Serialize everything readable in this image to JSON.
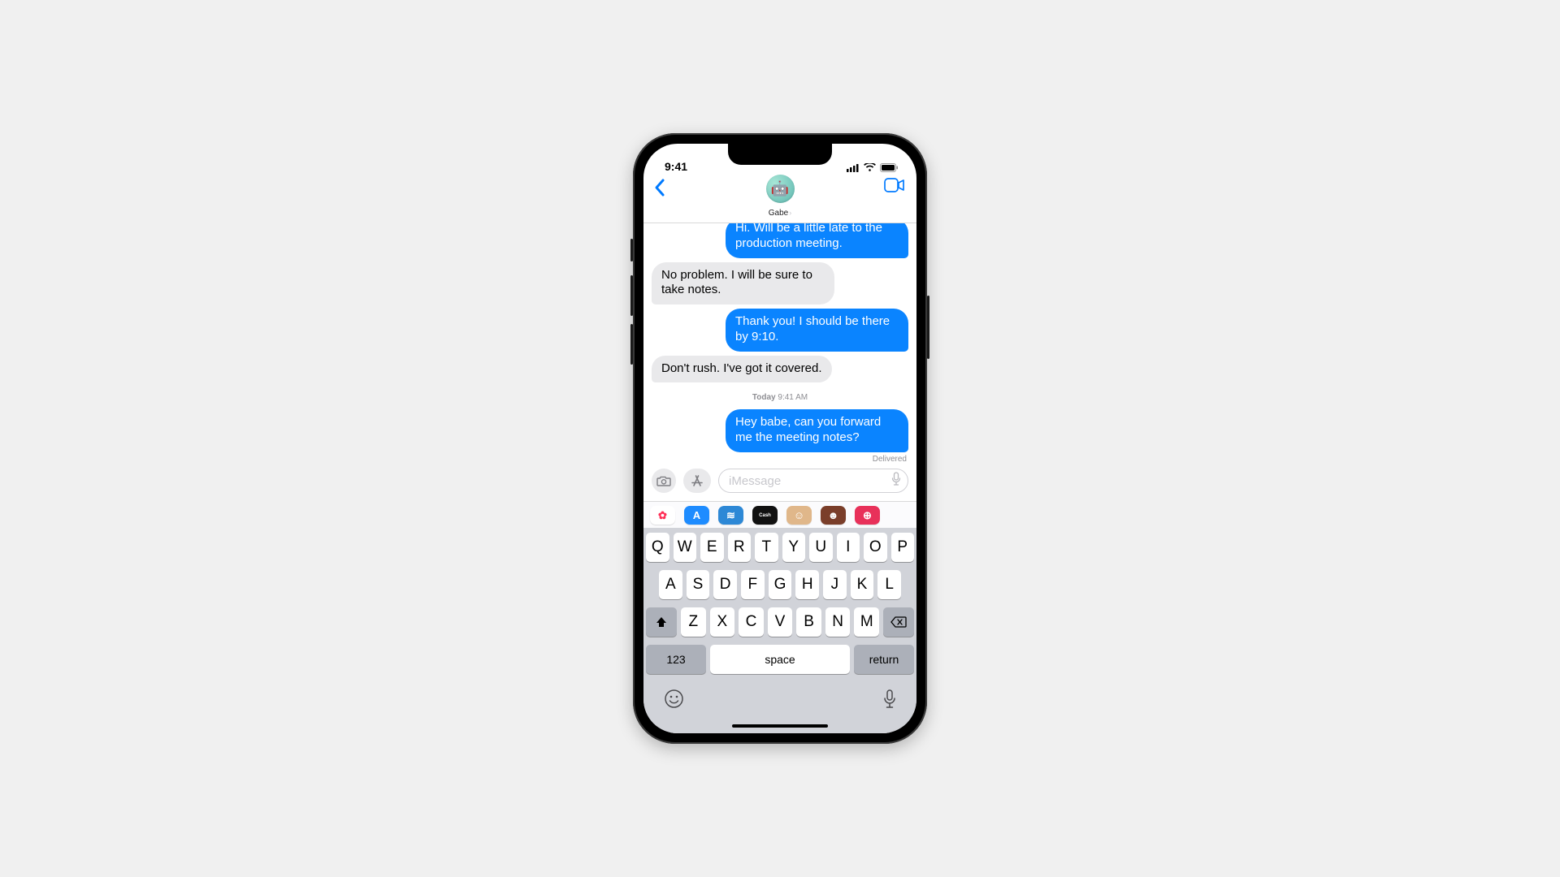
{
  "statusbar": {
    "time": "9:41"
  },
  "navbar": {
    "contact_name": "Gabe",
    "avatar_emoji": "🤖"
  },
  "messages": {
    "items": [
      {
        "kind": "sent_partial",
        "text": "Hi. Will be a little late to the production meeting."
      },
      {
        "kind": "received",
        "text": "No problem. I will be sure to take notes."
      },
      {
        "kind": "sent",
        "text": "Thank you! I should be there by 9:10."
      },
      {
        "kind": "received",
        "text": "Don't rush. I've got it covered."
      },
      {
        "kind": "timestamp",
        "prefix": "Today",
        "time": "9:41 AM"
      },
      {
        "kind": "sent",
        "text": "Hey babe, can you forward me the meeting notes?"
      }
    ],
    "delivered_label": "Delivered"
  },
  "input": {
    "placeholder": "iMessage"
  },
  "appstrip": {
    "items": [
      {
        "name": "photos-app-icon",
        "bg": "#ffffff",
        "txt": "✿"
      },
      {
        "name": "appstore-app-icon",
        "bg": "#1e8cff",
        "txt": "A"
      },
      {
        "name": "audio-app-icon",
        "bg": "#2d88d6",
        "txt": "≋"
      },
      {
        "name": "applecash-app-icon",
        "bg": "#111111",
        "txt": "Cash"
      },
      {
        "name": "memoji-app-icon",
        "bg": "#e0b78a",
        "txt": "☺"
      },
      {
        "name": "animoji-app-icon",
        "bg": "#7a3e2a",
        "txt": "☻"
      },
      {
        "name": "hashtag-app-icon",
        "bg": "#e8315a",
        "txt": "⊕"
      }
    ]
  },
  "keyboard": {
    "row1": [
      "Q",
      "W",
      "E",
      "R",
      "T",
      "Y",
      "U",
      "I",
      "O",
      "P"
    ],
    "row2": [
      "A",
      "S",
      "D",
      "F",
      "G",
      "H",
      "J",
      "K",
      "L"
    ],
    "row3": [
      "Z",
      "X",
      "C",
      "V",
      "B",
      "N",
      "M"
    ],
    "num_label": "123",
    "space_label": "space",
    "return_label": "return"
  }
}
